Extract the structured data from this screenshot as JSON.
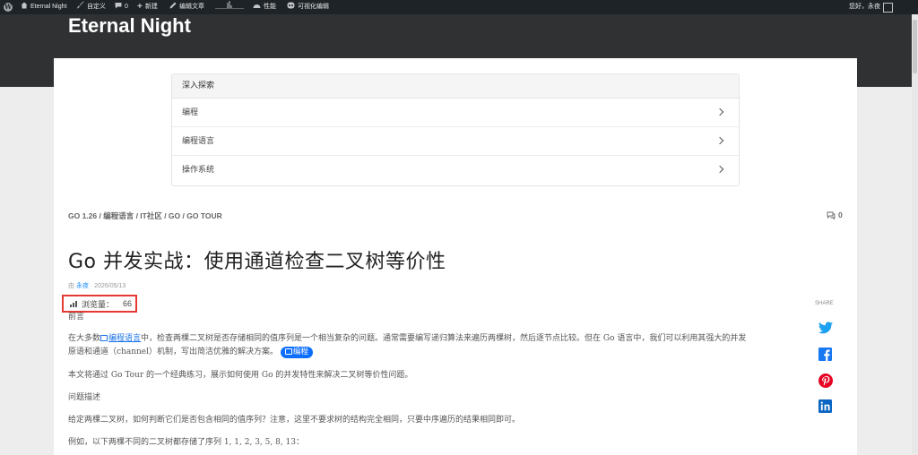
{
  "adminbar": {
    "site_name": "Eternal Night",
    "customize": "自定义",
    "comments_count": "0",
    "new": "新建",
    "edit_post": "编辑文章",
    "performance": "性能",
    "visual_edit": "可视化编辑",
    "greeting": "您好，永夜"
  },
  "header": {
    "title": "Eternal Night"
  },
  "explore": {
    "heading": "深入探索",
    "items": [
      {
        "label": "编程"
      },
      {
        "label": "编程语言"
      },
      {
        "label": "操作系统"
      }
    ]
  },
  "breadcrumb": {
    "text": "GO 1.26 / 编程语言 / IT社区 / GO / GO TOUR",
    "comments_count": "0"
  },
  "post": {
    "title": "Go 并发实战：使用通道检查二叉树等价性",
    "by": "由",
    "author": "永夜",
    "date": "· 2026/05/13",
    "views_label": "浏览量：",
    "views_count": "66",
    "para_preface": "前言",
    "para1_a": "在大多数",
    "para1_link": "编程语言",
    "para1_b": "中，检查两棵二叉树是否存储相同的值序列是一个相当复杂的问题。通常需要编写递归算法来遍历两棵树，然后逐节点比较。但在 Go 语言中，我们可以利用其强大的并发",
    "para1_c": "原语和通道（channel）机制，写出简洁优雅的解决方案。",
    "para1_tag": "编程",
    "para2": "本文将通过 Go Tour 的一个经典练习，展示如何使用 Go 的并发特性来解决二叉树等价性问题。",
    "para_problem": "问题描述",
    "para3": "给定两棵二叉树，如何判断它们是否包含相同的值序列？注意，这里不要求树的结构完全相同，只要中序遍历的结果相同即可。",
    "para4": "例如，以下两棵不同的二叉树都存储了序列 1, 1, 2, 3, 5, 8, 13："
  },
  "share": {
    "label": "SHARE"
  },
  "colors": {
    "adminbar_bg": "#1d2327",
    "header_bg": "#2f3133",
    "link": "#1a73e8",
    "highlight_border": "#e53935",
    "twitter": "#1da1f2",
    "facebook": "#1877f2",
    "pinterest": "#e60023",
    "linkedin": "#0a66c2"
  }
}
